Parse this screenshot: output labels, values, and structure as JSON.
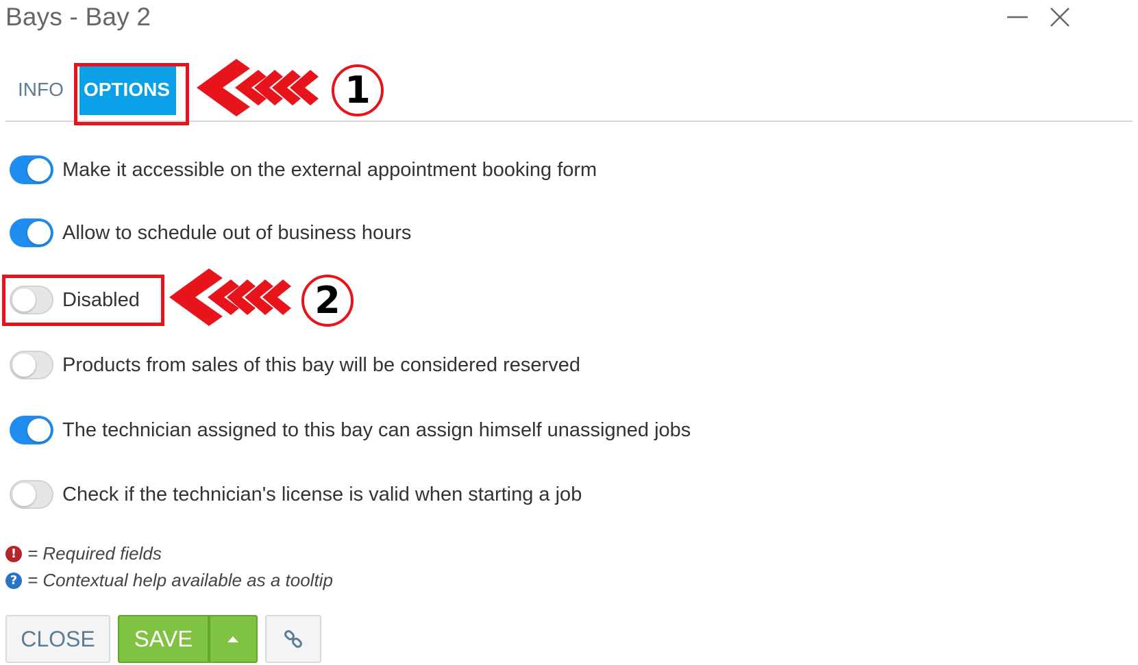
{
  "window": {
    "title": "Bays - Bay 2"
  },
  "tabs": [
    {
      "label": "INFO",
      "active": false
    },
    {
      "label": "OPTIONS",
      "active": true
    }
  ],
  "annotations": {
    "badge1": "1",
    "badge2": "2",
    "highlight_color": "#e8141c"
  },
  "options": [
    {
      "label": "Make it accessible on the external appointment booking form",
      "enabled": true
    },
    {
      "label": "Allow to schedule out of business hours",
      "enabled": true
    },
    {
      "label": "Disabled",
      "enabled": false
    },
    {
      "label": "Products from sales of this bay will be considered reserved",
      "enabled": false
    },
    {
      "label": "The technician assigned to this bay can assign himself unassigned jobs",
      "enabled": true
    },
    {
      "label": "Check if the technician's license is valid when starting a job",
      "enabled": false
    }
  ],
  "legend": {
    "required": "= Required fields",
    "help": "= Contextual help available as a tooltip"
  },
  "buttons": {
    "close": "CLOSE",
    "save": "SAVE"
  },
  "colors": {
    "accent": "#1f8df0",
    "tab_active": "#0aa0e8",
    "save": "#80c242"
  }
}
